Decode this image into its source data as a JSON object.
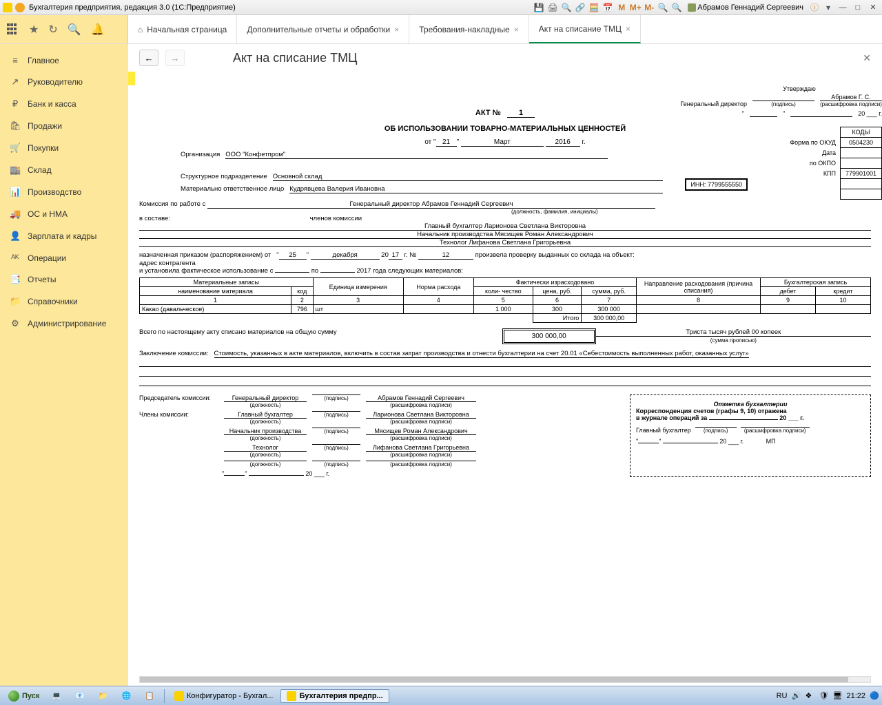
{
  "titlebar": {
    "title": "Бухгалтерия предприятия, редакция 3.0  (1С:Предприятие)",
    "user": "Абрамов Геннадий Сергеевич",
    "m_labels": [
      "M",
      "M+",
      "M-"
    ]
  },
  "tabs": [
    {
      "label": "Начальная страница",
      "home": true,
      "closable": false
    },
    {
      "label": "Дополнительные отчеты и обработки",
      "closable": true
    },
    {
      "label": "Требования-накладные",
      "closable": true
    },
    {
      "label": "Акт на списание ТМЦ",
      "closable": true,
      "active": true
    }
  ],
  "sidebar": [
    {
      "icon": "≡",
      "label": "Главное"
    },
    {
      "icon": "↗",
      "label": "Руководителю"
    },
    {
      "icon": "₽",
      "label": "Банк и касса"
    },
    {
      "icon": "🛍",
      "label": "Продажи"
    },
    {
      "icon": "🛒",
      "label": "Покупки"
    },
    {
      "icon": "🏬",
      "label": "Склад"
    },
    {
      "icon": "📊",
      "label": "Производство"
    },
    {
      "icon": "🚚",
      "label": "ОС и НМА"
    },
    {
      "icon": "👤",
      "label": "Зарплата и кадры"
    },
    {
      "icon": "ᴬᴷ",
      "label": "Операции"
    },
    {
      "icon": "📑",
      "label": "Отчеты"
    },
    {
      "icon": "📁",
      "label": "Справочники"
    },
    {
      "icon": "⚙",
      "label": "Администрирование"
    }
  ],
  "content": {
    "title": "Акт на списание ТМЦ"
  },
  "doc": {
    "approve": {
      "title": "Утверждаю",
      "role": "Генеральный директор",
      "signature_hint": "(подпись)",
      "decoding": "Абрамов Г. С.",
      "decoding_hint": "(расшифровка подписи)",
      "date_suffix": "20 ___ г."
    },
    "act_label": "АКТ №",
    "act_no": "1",
    "subtitle": "ОБ ИСПОЛЬЗОВАНИИ ТОВАРНО-МАТЕРИАЛЬНЫХ ЦЕННОСТЕЙ",
    "date": {
      "prefix": "от",
      "day": "21",
      "month": "Март",
      "year": "2016",
      "suffix": "г."
    },
    "org_label": "Организация",
    "org": "ООО \"Конфетпром\"",
    "codes": {
      "header": "КОДЫ",
      "okud_label": "Форма по ОКУД",
      "okud": "0504230",
      "date_label": "Дата",
      "okpo_label": "по ОКПО",
      "kpp_label": "КПП",
      "kpp": "779901001",
      "inn_label": "ИНН:",
      "inn": "7799555550"
    },
    "division_label": "Структурное подразделение",
    "division": "Основной склад",
    "responsible_label": "Материально ответственное лицо",
    "responsible": "Кудрявцева Валерия Ивановна",
    "commission_intro": "Комиссия по работе с",
    "commission_sub": "(должность, фамилия, инициалы)",
    "commission_head": "Генеральный директор  Абрамов Геннадий Сергеевич",
    "members_label": "в составе:",
    "members_hint": "членов комиссии",
    "members": [
      "Главный бухгалтер  Ларионова Светлана Викторовна",
      "Начальник производства  Мясищев Роман Александрович",
      "Технолог Лифанова Светлана Григорьевна"
    ],
    "appointment": {
      "prefix": "назначенная приказом (распоряжением) от",
      "day": "25",
      "month": "декабря",
      "yy": "17",
      "no_label": "г.  №",
      "no": "12",
      "suffix": "произвела проверку выданных со склада на объект:",
      "addr_label": "адрес контрагента",
      "installed_label": "и установила фактическое использование с",
      "to": "по",
      "note": "2017 года следующих материалов:"
    },
    "table": {
      "headers": {
        "materials": "Материальные запасы",
        "name": "наименование материала",
        "code": "код",
        "unit": "Единица измерения",
        "norm": "Норма расхода",
        "actual": "Фактически израсходовано",
        "qty": "коли- чество",
        "price": "цена, руб.",
        "sum": "сумма, руб.",
        "direction": "Направление расходования (причина списания)",
        "accounting": "Бухгалтерская запись",
        "debit": "дебет",
        "credit": "кредит"
      },
      "cols": [
        "1",
        "2",
        "3",
        "4",
        "5",
        "6",
        "7",
        "8",
        "9",
        "10"
      ],
      "rows": [
        {
          "name": "Какао (давальческое)",
          "code": "796",
          "unit": "шт",
          "norm": "",
          "qty": "1 000",
          "price": "300",
          "sum": "300 000",
          "direction": "",
          "debit": "",
          "credit": ""
        }
      ],
      "total_label": "Итого",
      "total": "300 000,00"
    },
    "total_text": "Всего по настоящему акту списано материалов на общую сумму",
    "total_amount": "300 000,00",
    "total_words": "Триста тысяч рублей 00 копеек",
    "total_words_hint": "(сумма прописью)",
    "conclusion_label": "Заключение комиссии:",
    "conclusion": "Стоимость, указанных в акте материалов, включить в состав затрат производства и отнести бухгалтерии на счет 20.01 «Себестоимость выполненных работ, оказанных услуг»",
    "signatures": {
      "head_label": "Председатель комиссии:",
      "members_label": "Члены комиссии:",
      "position_hint": "(должность)",
      "signature_hint": "(подпись)",
      "decoding_hint": "(расшифровка подписи)",
      "rows": [
        {
          "position": "Генеральный директор",
          "name": "Абрамов Геннадий Сергеевич"
        },
        {
          "position": "Главный бухгалтер",
          "name": "Ларионова Светлана Викторовна"
        },
        {
          "position": "Начальник производства",
          "name": "Мясищев Роман Александрович"
        },
        {
          "position": "Технолог",
          "name": "Лифанова Светлана Григорьевна"
        },
        {
          "position": "",
          "name": ""
        }
      ],
      "date_suffix": "20 ___ г."
    },
    "stamp": {
      "title": "Отметка бухгалтерии",
      "line1": "Корреспонденция счетов (графы 9, 10) отражена",
      "line2": "в журнале операций за",
      "date_suffix": "20 ___ г.",
      "chief_label": "Главный бухгалтер",
      "signature_hint": "(подпись)",
      "decoding_hint": "(расшифровка подписи)",
      "mp": "МП"
    }
  },
  "taskbar": {
    "start": "Пуск",
    "items": [
      {
        "label": "Конфигуратор - Бухгал...",
        "active": false
      },
      {
        "label": "Бухгалтерия предпр...",
        "active": true
      }
    ],
    "lang": "RU",
    "time": "21:22"
  }
}
